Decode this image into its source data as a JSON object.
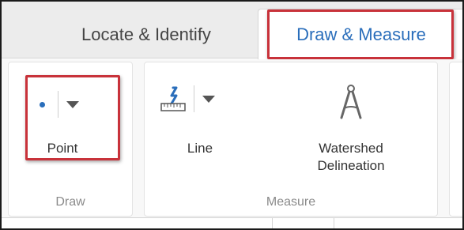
{
  "tabs": {
    "locate": "Locate & Identify",
    "draw_measure": "Draw & Measure"
  },
  "groups": {
    "draw": {
      "title": "Draw",
      "point_label": "Point"
    },
    "measure": {
      "title": "Measure",
      "line_label": "Line",
      "watershed_label_line1": "Watershed",
      "watershed_label_line2": "Delineation"
    }
  },
  "colors": {
    "accent": "#2a6ebb",
    "highlight": "#c8323a"
  },
  "icons": {
    "point": "point-dot-icon",
    "line": "line-ruler-icon",
    "watershed": "compass-icon",
    "dropdown": "chevron-down-icon"
  }
}
